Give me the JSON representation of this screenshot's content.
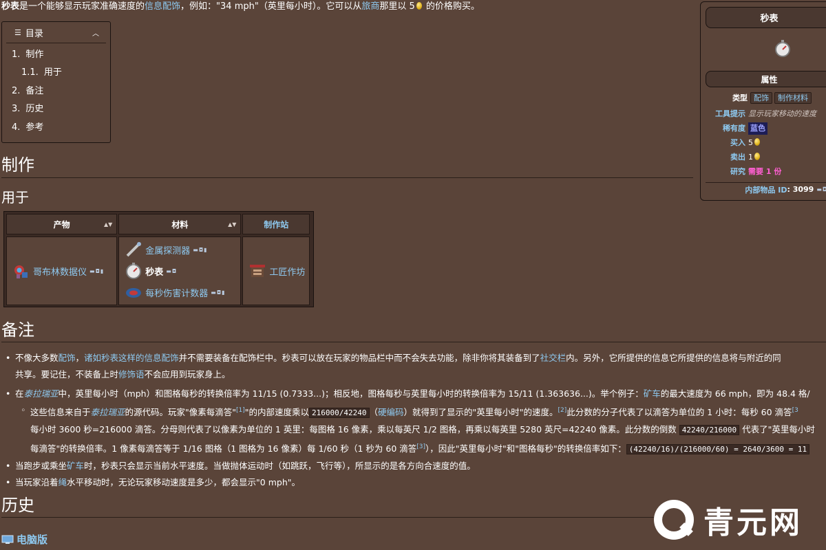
{
  "intro": {
    "bold": "秒表",
    "t1": "是一个能够显示玩家准确速度的",
    "link1": "信息配饰",
    "t2": "，例如：\"34 mph\"（英里每小时）。它可以从",
    "link2": "旅商",
    "t3": "那里以 5",
    "t4": " 的价格购买。"
  },
  "toc": {
    "title": "目录",
    "items": [
      {
        "num": "1.",
        "label": "制作"
      },
      {
        "num": "1.1.",
        "label": "用于"
      },
      {
        "num": "2.",
        "label": "备注"
      },
      {
        "num": "3.",
        "label": "历史"
      },
      {
        "num": "4.",
        "label": "参考"
      }
    ]
  },
  "sections": {
    "crafting": "制作",
    "used_in": "用于",
    "notes": "备注",
    "history": "历史"
  },
  "craft_table": {
    "headers": [
      "产物",
      "材料",
      "制作站"
    ],
    "result": "哥布林数据仪",
    "materials": [
      "金属探测器",
      "秒表",
      "每秒伤害计数器"
    ],
    "station": "工匠作坊"
  },
  "notes": {
    "n1_a": "不像大多数",
    "n1_link1": "配饰",
    "n1_b": "，",
    "n1_link2": "诸如秒表这样的信息配饰",
    "n1_c": "并不需要装备在配饰栏中。秒表可以放在玩家的物品栏中而不会失去功能，除非你将其装备到了",
    "n1_link3": "社交栏",
    "n1_d": "内。另外，它所提供的信息它所提供的信息将与附近的同",
    "n1_line2_a": "共享。要记住，不装备上时",
    "n1_line2_link": "修饰语",
    "n1_line2_b": "不会应用到玩家身上。",
    "n2_a": "在",
    "n2_link1": "泰拉瑞亚",
    "n2_b": "中，英里每小时（mph）和图格每秒的转换倍率为 11/15 (0.7333...)；相反地，图格每秒与英里每小时的转换倍率为 15/11 (1.363636...)。举个例子：",
    "n2_link2": "矿车",
    "n2_c": "的最大速度为 66 mph，即为 48.4 格/",
    "n3_a": "这些信息来自于",
    "n3_link1": "泰拉瑞亚",
    "n3_b": "的源代码。玩家\"像素每滴答\"",
    "n3_sup1": "[1]",
    "n3_c": "\"的内部速度乘以",
    "n3_code1": "216000/42240",
    "n3_d": "（",
    "n3_link2": "硬编码",
    "n3_e": "）就得到了显示的\"英里每小时\"的速度。",
    "n3_sup2": "[2]",
    "n3_f": "此分数的分子代表了以滴答为单位的 1 小时：每秒 60 滴答",
    "n3_sup3": "[3",
    "n3_line2_a": "每小时 3600 秒=216000 滴答。分母则代表了以像素为单位的 1 英里：每图格 16 像素，乘以每英尺 1/2 图格，再乘以每英里 5280 英尺=42240 像素。此分数的倒数",
    "n3_line2_code": "42240/216000",
    "n3_line2_b": "代表了\"英里每小时",
    "n3_line3_a": "每滴答\"的转换倍率。1 像素每滴答等于 1/16 图格（1 图格为 16 像素）每 1/60 秒（1 秒为 60 滴答",
    "n3_line3_sup": "[3]",
    "n3_line3_b": "），因此\"英里每小时\"和\"图格每秒\"的转换倍率如下：",
    "n3_line3_code": "(42240/16)/(216000/60) = 2640/3600 = 11",
    "n4_a": "当跑步或乘坐",
    "n4_link": "矿车",
    "n4_b": "时，秒表只会显示当前水平速度。当做抛体运动时（如跳跃，飞行等），所显示的是各方向合速度的值。",
    "n5_a": "当玩家沿着",
    "n5_link": "绳",
    "n5_b": "水平移动时，无论玩家移动速度是多少，都会显示\"0 mph\"。"
  },
  "history": {
    "pc_label": "电脑版"
  },
  "infobox": {
    "title": "秒表",
    "subtitle": "属性",
    "type_key": "类型",
    "type_tags": [
      "配饰",
      "制作材料"
    ],
    "tooltip_key": "工具提示",
    "tooltip_val": "显示玩家移动的速度",
    "rarity_key": "稀有度",
    "rarity_val": "蓝色",
    "buy_key": "买入",
    "buy_val": "5",
    "sell_key": "卖出",
    "sell_val": "1",
    "research_key": "研究",
    "research_val": "需要 1 份",
    "id_key": "内部物品 ID",
    "id_val": "3099"
  },
  "watermark": {
    "text": "青元网"
  },
  "colors": {
    "background": "#5a4439",
    "link": "#8ec9f0",
    "research": "#ff5fd2",
    "rarity_blue": "#9da3ff"
  }
}
